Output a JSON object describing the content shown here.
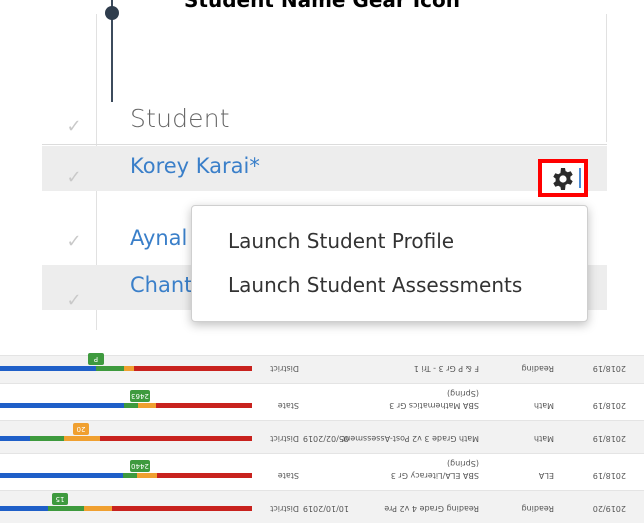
{
  "page_title": "Student Name Gear Icon",
  "header": {
    "label": "Student"
  },
  "check_glyph": "✓",
  "students": [
    {
      "name": "Korey Karai*"
    },
    {
      "name": "Aynal"
    },
    {
      "name": "Chant"
    }
  ],
  "gear": {
    "icon": "gear-icon",
    "highlight_color": "#ff0000"
  },
  "menu": {
    "items": [
      "Launch Student Profile",
      "Launch Student Assessments"
    ]
  },
  "assessments": [
    {
      "year": "2019/20",
      "subject": "Reading",
      "name": "Reading Grade 4 v2 Pre",
      "date": "10/10/2019",
      "level": "District",
      "score": "15",
      "tag_color": "#3e9a3e"
    },
    {
      "year": "2018/19",
      "subject": "ELA",
      "name": "SBA ELA/Literacy Gr 3",
      "sub": "(Spring)",
      "date": "",
      "level": "State",
      "score": "2440",
      "tag_color": "#3e9a3e"
    },
    {
      "year": "2018/19",
      "subject": "Math",
      "name": "Math Grade 3 v2 Post-Assessment",
      "date": "05/02/2019",
      "level": "District",
      "score": "20",
      "tag_color": "#f0a030"
    },
    {
      "year": "2018/19",
      "subject": "Math",
      "name": "SBA Mathematics Gr 3",
      "sub": "(Spring)",
      "date": "",
      "level": "State",
      "score": "2463",
      "tag_color": "#3e9a3e"
    },
    {
      "year": "2018/19",
      "subject": "Reading",
      "name": "F & P Gr 3 - Tri 1",
      "date": "",
      "level": "District",
      "score": "P",
      "tag_color": "#3e9a3e"
    }
  ]
}
